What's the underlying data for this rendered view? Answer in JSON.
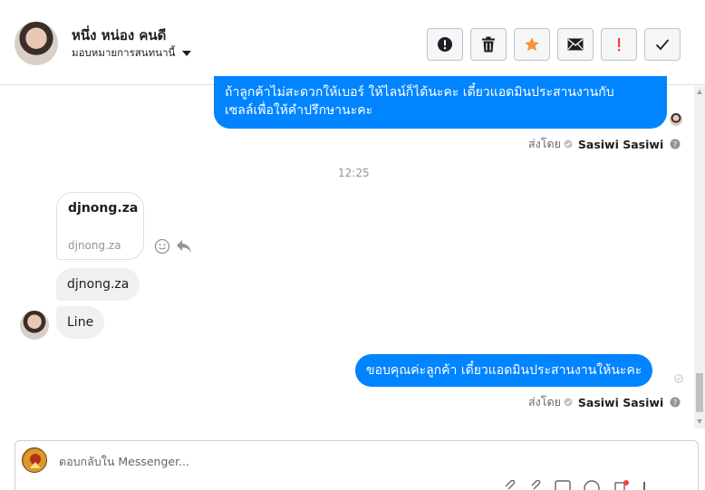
{
  "header": {
    "contact_name": "หนึ่ง หน่อง คนดี",
    "assign_label": "มอบหมายการสนทนานี้"
  },
  "toolbar": {
    "buttons": [
      {
        "name": "spam",
        "icon": "alert-circle-icon"
      },
      {
        "name": "delete",
        "icon": "trash-icon"
      },
      {
        "name": "star",
        "icon": "star-icon",
        "color": "#f7923b"
      },
      {
        "name": "mark-unread",
        "icon": "envelope-icon"
      },
      {
        "name": "follow-up",
        "icon": "exclamation-icon",
        "color": "#fa3e3e"
      },
      {
        "name": "done",
        "icon": "check-icon"
      }
    ]
  },
  "thread": {
    "messages": [
      {
        "type": "outgoing",
        "lines": [
          "ถ้าลูกค้าไม่สะดวกให้เบอร์ ให้ไลน์ก็ได้นะคะ  เดี๋ยวแอดมินประสานงานกับ",
          "เซลล์เพื่อให้คำปรึกษานะคะ"
        ]
      },
      {
        "type": "sent-by",
        "prefix": "ส่งโดย",
        "agent": "Sasiwi Sasiwi"
      },
      {
        "type": "timestamp",
        "text": "12:25"
      },
      {
        "type": "link-card",
        "title": "djnong.za",
        "domain": "djnong.za"
      },
      {
        "type": "incoming",
        "text": "djnong.za"
      },
      {
        "type": "incoming",
        "text": "Line"
      },
      {
        "type": "outgoing",
        "text": "ขอบคุณค่ะลูกค้า เดี๋ยวแอดมินประสานงานให้นะคะ"
      },
      {
        "type": "sent-by",
        "prefix": "ส่งโดย",
        "agent": "Sasiwi Sasiwi"
      }
    ]
  },
  "composer": {
    "placeholder": "ตอบกลับใน Messenger..."
  },
  "colors": {
    "outgoing_bubble": "#0084ff",
    "incoming_bubble": "#f0f0f0",
    "accent_star": "#f7923b",
    "accent_red": "#fa3e3e"
  }
}
